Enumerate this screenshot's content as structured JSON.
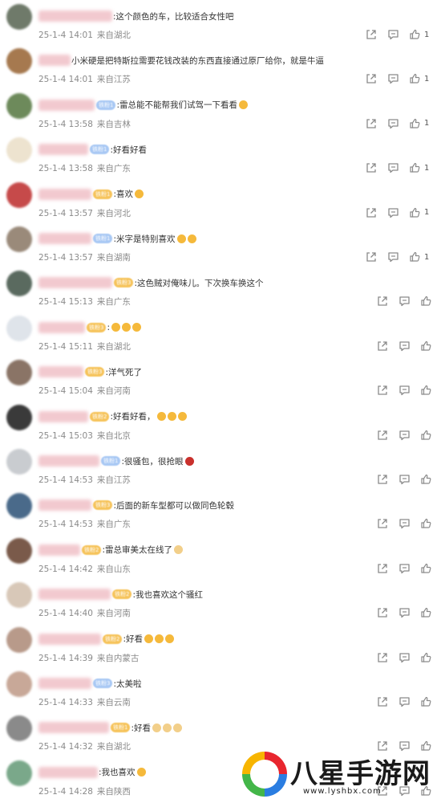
{
  "colors": {
    "meta": "#8a8a8a",
    "text": "#333333",
    "icon": "#8a8a8a",
    "badge_blue": "#a8c8f4",
    "badge_gold": "#f6c35a"
  },
  "comments": [
    {
      "text": ":这个颜色的车，比较适合女性吧",
      "date": "25-1-4 14:01",
      "location": "来自湖北",
      "likes": "1",
      "badge": "",
      "badge_color": "",
      "emojis": [],
      "avatar": "#6f7a6a"
    },
    {
      "text": "小米硬是把特斯拉需要花钱改装的东西直接通过原厂给你，就是牛逼",
      "date": "25-1-4 14:01",
      "location": "来自江苏",
      "likes": "1",
      "badge": "",
      "badge_color": "",
      "emojis": [],
      "avatar": "#a6794f"
    },
    {
      "text": ":雷总能不能帮我们试驾一下看看",
      "date": "25-1-4 13:58",
      "location": "来自吉林",
      "likes": "1",
      "badge": "铁粉1",
      "badge_color": "blue",
      "emojis": [
        "#f5b93b"
      ],
      "avatar": "#6d8a5b"
    },
    {
      "text": ":好看好看",
      "date": "25-1-4 13:58",
      "location": "来自广东",
      "likes": "1",
      "badge": "铁粉1",
      "badge_color": "blue",
      "emojis": [],
      "avatar": "#ede3cf"
    },
    {
      "text": ":喜欢",
      "date": "25-1-4 13:57",
      "location": "来自河北",
      "likes": "1",
      "badge": "铁粉1",
      "badge_color": "gold",
      "emojis": [
        "#f5b93b"
      ],
      "avatar": "#c64a4a"
    },
    {
      "text": ":米字是特别喜欢",
      "date": "25-1-4 13:57",
      "location": "来自湖南",
      "likes": "1",
      "badge": "铁粉1",
      "badge_color": "blue",
      "emojis": [
        "#f5b93b",
        "#f5b93b"
      ],
      "avatar": "#9a8a7a"
    },
    {
      "text": ":这色贼对俺味儿。下次换车换这个",
      "date": "25-1-4 15:13",
      "location": "来自广东",
      "likes": "",
      "badge": "铁粉3",
      "badge_color": "gold",
      "emojis": [],
      "avatar": "#5a6a5f"
    },
    {
      "text": ":",
      "date": "25-1-4 15:11",
      "location": "来自湖北",
      "likes": "",
      "badge": "铁粉3",
      "badge_color": "gold",
      "emojis": [
        "#f5b93b",
        "#f5b93b",
        "#f5b93b"
      ],
      "avatar": "#dfe4ea"
    },
    {
      "text": ":洋气死了",
      "date": "25-1-4 15:04",
      "location": "来自河南",
      "likes": "",
      "badge": "铁粉3",
      "badge_color": "gold",
      "emojis": [],
      "avatar": "#8a7466"
    },
    {
      "text": ":好看好看，",
      "date": "25-1-4 15:03",
      "location": "来自北京",
      "likes": "",
      "badge": "铁粉2",
      "badge_color": "gold",
      "emojis": [
        "#f5b93b",
        "#f5b93b",
        "#f5b93b"
      ],
      "avatar": "#3a3a3a"
    },
    {
      "text": ":很骚包，很抢眼",
      "date": "25-1-4 14:53",
      "location": "来自江苏",
      "likes": "",
      "badge": "铁粉1",
      "badge_color": "blue",
      "emojis": [
        "#c9302c"
      ],
      "avatar": "#c9ccd0"
    },
    {
      "text": ":后面的新车型都可以做同色轮毂",
      "date": "25-1-4 14:53",
      "location": "来自广东",
      "likes": "",
      "badge": "铁粉3",
      "badge_color": "gold",
      "emojis": [],
      "avatar": "#4a6a8a"
    },
    {
      "text": ":雷总审美太在线了",
      "date": "25-1-4 14:42",
      "location": "来自山东",
      "likes": "",
      "badge": "铁粉2",
      "badge_color": "gold",
      "emojis": [
        "#f2cf8a"
      ],
      "avatar": "#7a5a4a"
    },
    {
      "text": ":我也喜欢这个骚红",
      "date": "25-1-4 14:40",
      "location": "来自河南",
      "likes": "",
      "badge": "铁粉2",
      "badge_color": "gold",
      "emojis": [],
      "avatar": "#d8c8b8"
    },
    {
      "text": ":好看",
      "date": "25-1-4 14:39",
      "location": "来自内蒙古",
      "likes": "",
      "badge": "铁粉2",
      "badge_color": "gold",
      "emojis": [
        "#f5b93b",
        "#f5b93b",
        "#f5b93b"
      ],
      "avatar": "#b89a8a"
    },
    {
      "text": ":太美啦",
      "date": "25-1-4 14:33",
      "location": "来自云南",
      "likes": "",
      "badge": "铁粉3",
      "badge_color": "blue",
      "emojis": [],
      "avatar": "#c8a898"
    },
    {
      "text": ":好看",
      "date": "25-1-4 14:32",
      "location": "来自湖北",
      "likes": "",
      "badge": "铁粉1",
      "badge_color": "gold",
      "emojis": [
        "#f2cf8a",
        "#f2cf8a",
        "#f2cf8a"
      ],
      "avatar": "#8a8a8a"
    },
    {
      "text": ":我也喜欢",
      "date": "25-1-4 14:28",
      "location": "来自陕西",
      "likes": "",
      "badge": "",
      "badge_color": "",
      "emojis": [
        "#f5b93b"
      ],
      "avatar": "#7aa88a"
    }
  ],
  "watermark": {
    "title": "八星手游网",
    "url": "www.lyshbx.com"
  }
}
